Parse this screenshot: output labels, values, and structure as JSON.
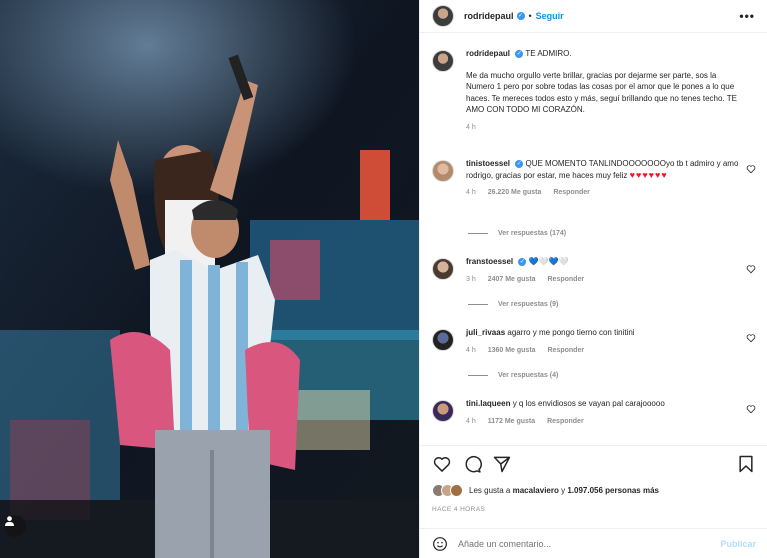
{
  "post": {
    "author": "rodridepaul",
    "follow_label": "Seguir",
    "more_icon": "•••",
    "caption_user": "rodridepaul",
    "caption_title": "TE ADMIRO.",
    "caption_body": "Me da mucho orgullo verte brillar, gracias por dejarme ser parte, sos la Numero 1 pero por sobre todas las cosas por el amor que le pones a lo que haces. Te mereces todos esto y más, seguí brillando que no tenes techo. TE AMO CON TODO MI CORAZÓN.",
    "caption_time": "4 h"
  },
  "comments": [
    {
      "user": "tinistoessel",
      "text": "QUE MOMENTO TANLINDOOOOOOOyo tb t admiro y amo rodrigo, gracias por estar, me haces muy feliz",
      "hearts": "♥♥♥♥♥♥",
      "time": "4 h",
      "likes": "26.220 Me gusta",
      "reply": "Responder",
      "replies": "Ver respuestas (174)"
    },
    {
      "user": "franstoessel",
      "text": "💙🤍💙🤍",
      "time": "3 h",
      "likes": "2407 Me gusta",
      "reply": "Responder",
      "replies": "Ver respuestas (9)"
    },
    {
      "user": "juli_rivaas",
      "text": "agarro y me pongo tierno con tinitini",
      "time": "4 h",
      "likes": "1360 Me gusta",
      "reply": "Responder",
      "replies": "Ver respuestas (4)"
    },
    {
      "user": "tini.laqueen",
      "text": "y q los envidiosos se vayan pal carajooooo",
      "time": "4 h",
      "likes": "1172 Me gusta",
      "reply": "Responder"
    }
  ],
  "actions": {
    "likes_prefix": "Les gusta a",
    "likes_user": "macalaviero",
    "likes_and": "y",
    "likes_count": "1.097.056 personas más",
    "time_ago": "HACE 4 HORAS",
    "comment_placeholder": "Añade un comentario...",
    "publish_label": "Publicar"
  },
  "colors": {
    "accent": "#0095f6",
    "verified": "#3897f0",
    "muted": "#8e8e8e",
    "publish_disabled": "#b2dffc"
  }
}
